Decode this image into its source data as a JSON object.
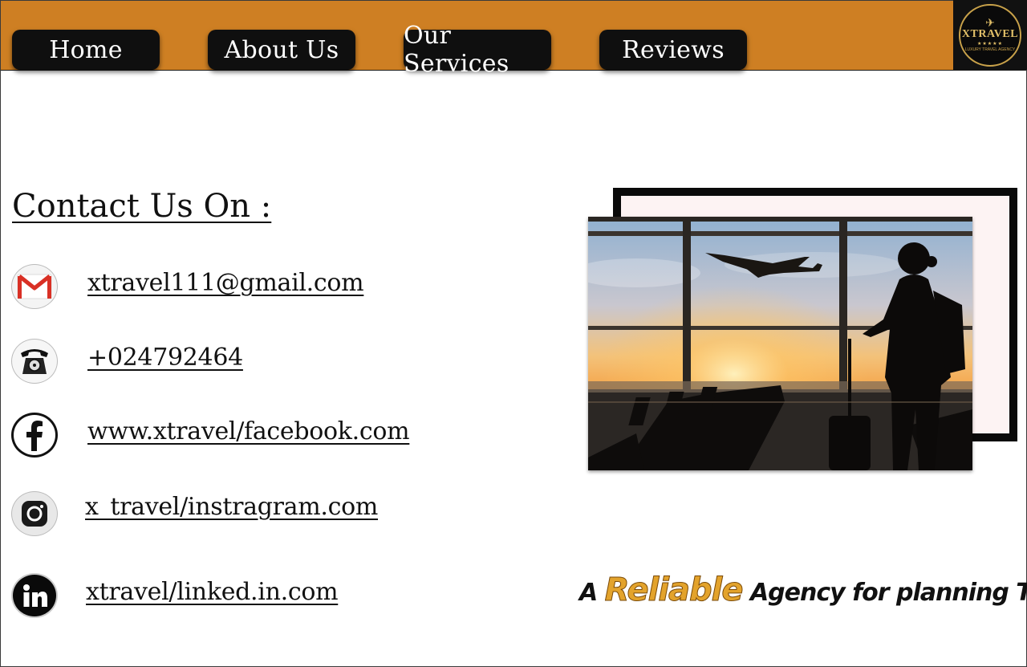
{
  "nav": {
    "items": [
      {
        "label": "Home"
      },
      {
        "label": "About Us"
      },
      {
        "label": "Our Services"
      },
      {
        "label": "Reviews"
      }
    ]
  },
  "logo": {
    "text": "XTRAVEL",
    "stars": "★★★★★",
    "sub": "LUXURY TRAVEL AGENCY"
  },
  "contact": {
    "title": "Contact Us On :",
    "items": [
      {
        "icon": "gmail-icon",
        "text": "xtravel111@gmail.com"
      },
      {
        "icon": "telephone-icon",
        "text": "+024792464"
      },
      {
        "icon": "facebook-icon",
        "text": "www.xtravel/facebook.com"
      },
      {
        "icon": "instagram-icon",
        "text": "x_travel/instragram.com"
      },
      {
        "icon": "linkedin-icon",
        "text": "xtravel/linked.in.com"
      }
    ]
  },
  "tagline": {
    "prefix": "A",
    "highlight": "Reliable",
    "suffix": "Agency for planning Trips"
  },
  "colors": {
    "header": "#ce7f23",
    "nav_button": "#0f0f0f",
    "accent": "#e3a32c"
  }
}
